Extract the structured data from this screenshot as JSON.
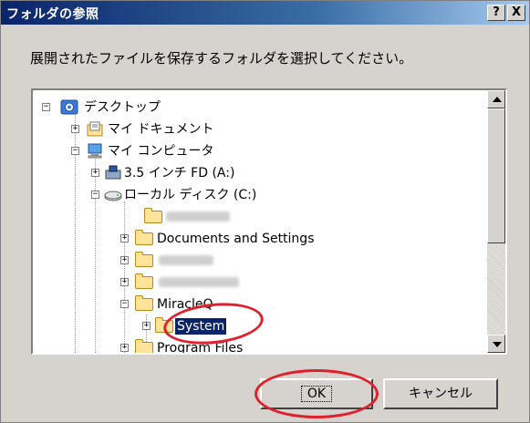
{
  "dialog": {
    "title": "フォルダの参照",
    "help_button": "?",
    "close_button": "X",
    "instruction": "展開されたファイルを保存するフォルダを選択してください。"
  },
  "tree": {
    "desktop": "デスクトップ",
    "my_documents": "マイ ドキュメント",
    "my_computer": "マイ コンピュータ",
    "floppy": "3.5 インチ FD (A:)",
    "local_disk": "ローカル ディスク (C:)",
    "documents_and_settings": "Documents and Settings",
    "miracleq": "MiracleQ",
    "system": "System",
    "program_files": "Program Files",
    "expand_plus": "+",
    "collapse_minus": "−"
  },
  "buttons": {
    "ok": "OK",
    "cancel": "キャンセル"
  },
  "annotations": {
    "color": "#e0202a"
  }
}
